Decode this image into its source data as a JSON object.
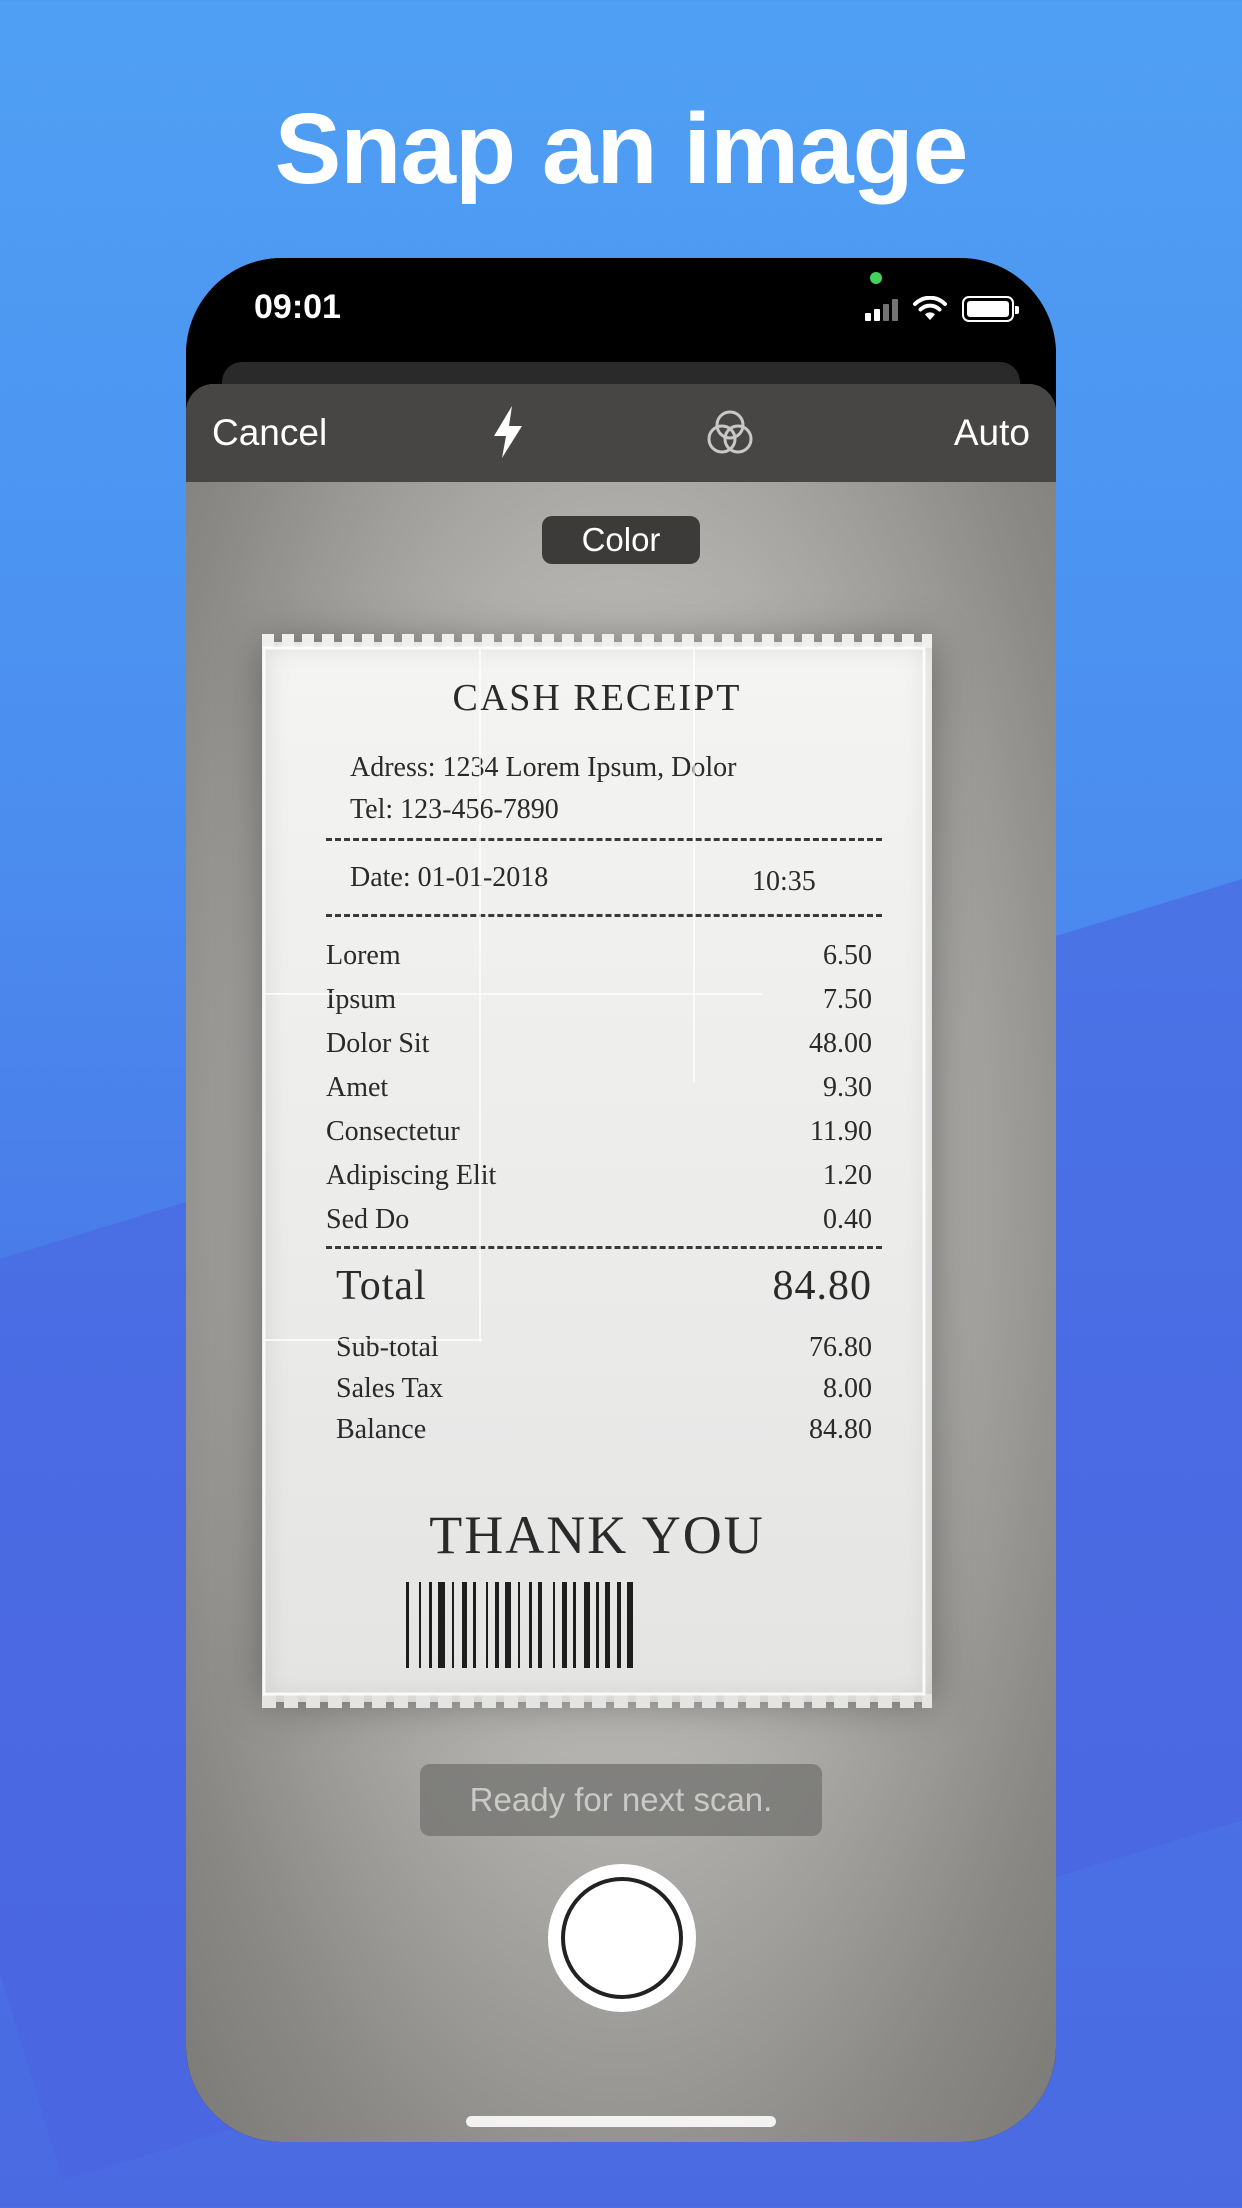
{
  "headline": "Snap an image",
  "status_bar": {
    "time": "09:01"
  },
  "toolbar": {
    "cancel_label": "Cancel",
    "flash_icon": "flash-icon",
    "filter_icon": "filter-icon",
    "auto_label": "Auto"
  },
  "mode_pill": "Color",
  "receipt": {
    "title": "CASH RECEIPT",
    "address": "Adress: 1234 Lorem Ipsum, Dolor",
    "tel": "Tel: 123-456-7890",
    "date": "Date: 01-01-2018",
    "time": "10:35",
    "items": [
      {
        "name": "Lorem",
        "price": "6.50"
      },
      {
        "name": "Ipsum",
        "price": "7.50"
      },
      {
        "name": "Dolor Sit",
        "price": "48.00"
      },
      {
        "name": "Amet",
        "price": "9.30"
      },
      {
        "name": "Consectetur",
        "price": "11.90"
      },
      {
        "name": "Adipiscing Elit",
        "price": "1.20"
      },
      {
        "name": "Sed Do",
        "price": "0.40"
      }
    ],
    "total_label": "Total",
    "total_value": "84.80",
    "summary": [
      {
        "label": "Sub-total",
        "value": "76.80"
      },
      {
        "label": "Sales Tax",
        "value": "8.00"
      },
      {
        "label": "Balance",
        "value": "84.80"
      }
    ],
    "thanks": "THANK YOU"
  },
  "status_message": "Ready for next scan.",
  "colors": {
    "background_top": "#4fa0f4",
    "background_bottom": "#4a6ae2",
    "toolbar": "#474645",
    "status_indicator": "#41d35b"
  }
}
